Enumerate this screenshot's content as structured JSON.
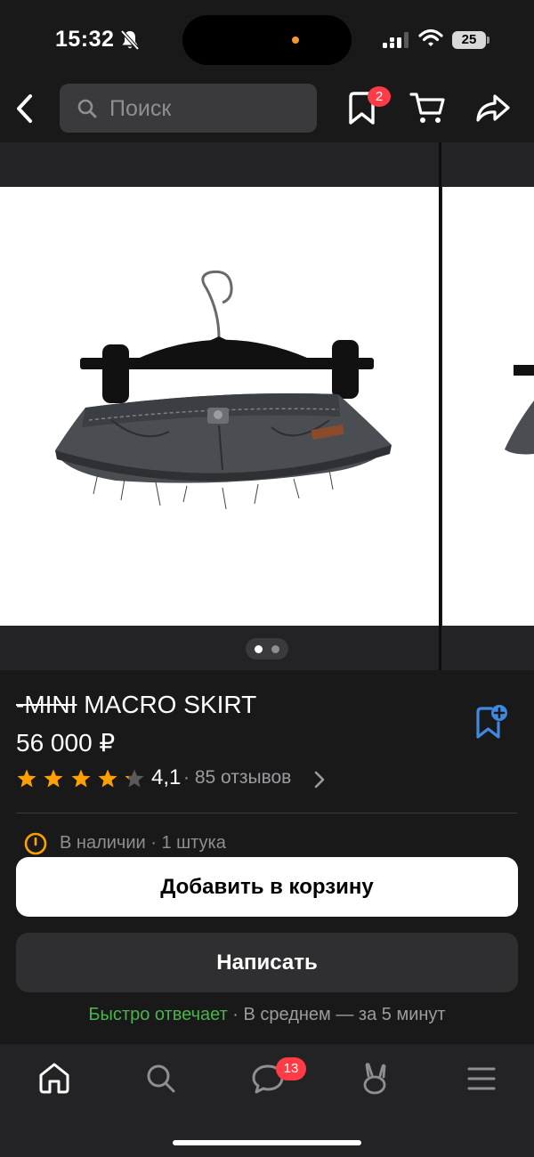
{
  "status_bar": {
    "time": "15:32",
    "battery": "25"
  },
  "header": {
    "search_placeholder": "Поиск",
    "favorites_badge": "2"
  },
  "gallery": {
    "image_description": "Denim micro mini skirt on black hanger",
    "page_count": 2,
    "active_page": 1
  },
  "product": {
    "title_struck": "-MINI",
    "title_rest": " MACRO SKIRT",
    "price": "56 000 ₽",
    "rating_value": 4.1,
    "rating_label": "4,1",
    "reviews_label": "· 85 отзывов",
    "stock_text": "В наличии · 1 штука"
  },
  "actions": {
    "add_to_cart": "Добавить в корзину",
    "write": "Написать"
  },
  "reply_info": {
    "fast": "Быстро отвечает",
    "rest": " · В среднем  — за 5 минут"
  },
  "tabbar": {
    "messages_badge": "13"
  },
  "colors": {
    "background": "#19191a",
    "accent_blue": "#3f8ae0",
    "star": "#ffa000",
    "badge": "#ff3b45",
    "green": "#4bb34b"
  }
}
